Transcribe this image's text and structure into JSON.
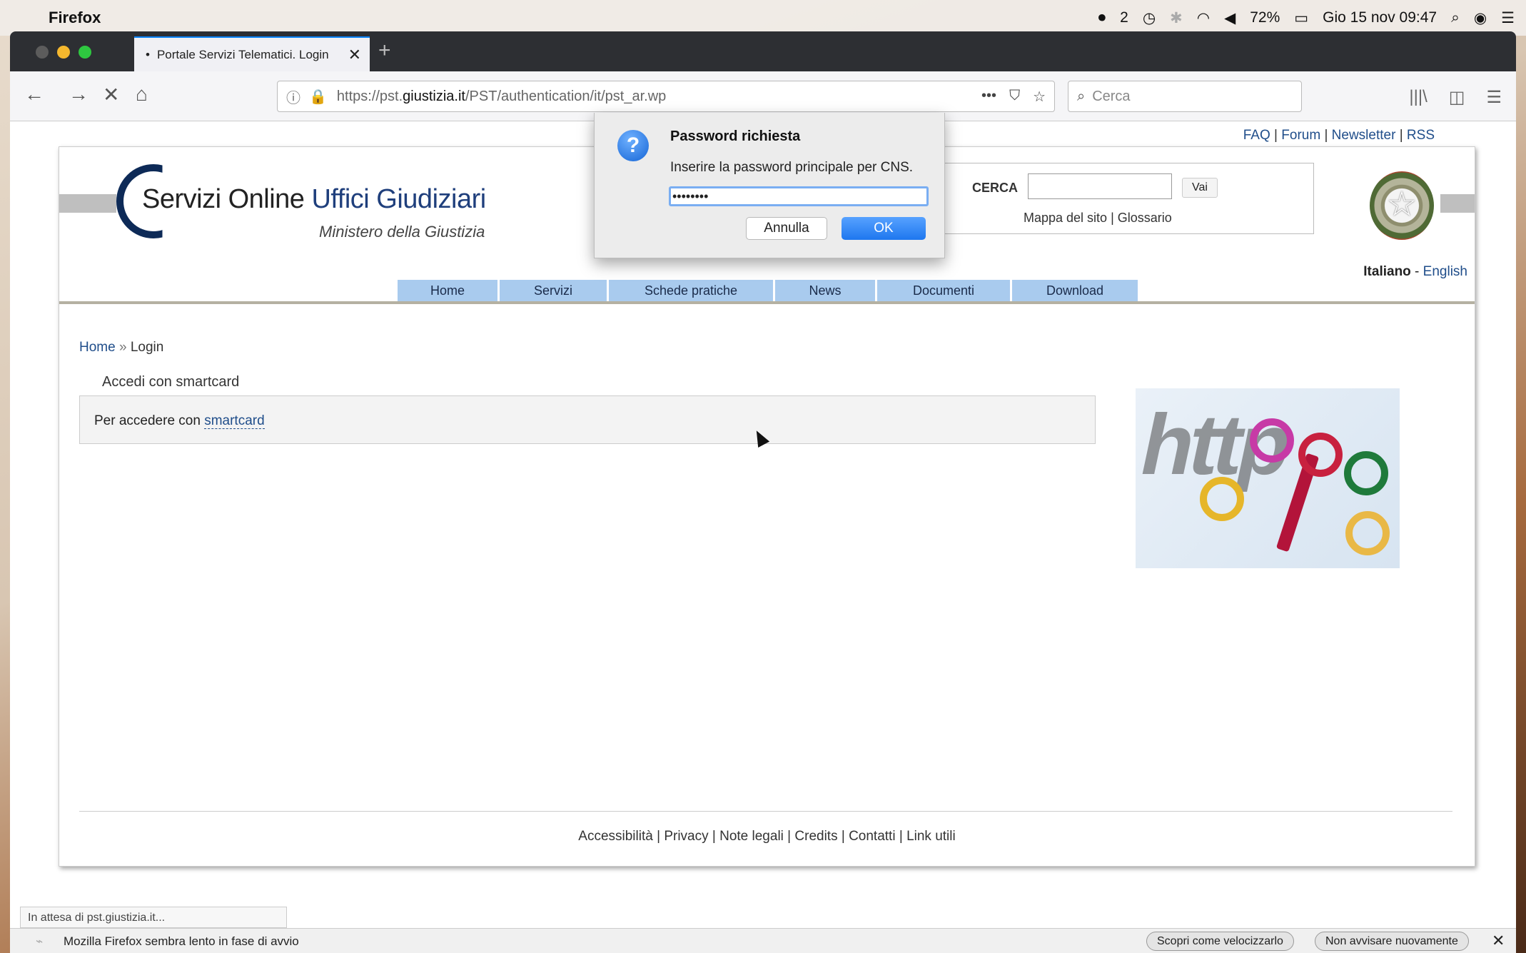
{
  "menubar": {
    "app_name": "Firefox",
    "badge_count": "2",
    "battery": "72%",
    "datetime": "Gio 15 nov  09:47"
  },
  "browser": {
    "tab_title": "Portale Servizi Telematici. Login",
    "url_prefix": "https://pst.",
    "url_domain": "giustizia.it",
    "url_path": "/PST/authentication/it/pst_ar.wp",
    "search_placeholder": "Cerca"
  },
  "site": {
    "top_links": [
      "FAQ",
      "Forum",
      "Newsletter",
      "RSS"
    ],
    "logo_main": "Servizi Online",
    "logo_blue": "Uffici Giudiziari",
    "logo_sub": "Ministero della Giustizia",
    "search_label": "CERCA",
    "search_button": "Vai",
    "sitemap_link": "Mappa del sito",
    "glossary_link": "Glossario",
    "lang_current": "Italiano",
    "lang_other": "English",
    "nav": [
      "Home",
      "Servizi",
      "Schede pratiche",
      "News",
      "Documenti",
      "Download"
    ],
    "breadcrumb_home": "Home",
    "breadcrumb_sep": " » ",
    "breadcrumb_current": "Login",
    "content_title": "Accedi con smartcard",
    "content_text": "Per accedere con ",
    "content_link": "smartcard",
    "footer_links": [
      "Accessibilità",
      "Privacy",
      "Note legali",
      "Credits",
      "Contatti",
      "Link utili"
    ]
  },
  "dialog": {
    "title": "Password richiesta",
    "message": "Inserire la password principale per CNS.",
    "password_value": "••••••••",
    "cancel_label": "Annulla",
    "ok_label": "OK"
  },
  "status_text": "In attesa di pst.giustizia.it...",
  "notification": {
    "message": "Mozilla Firefox sembra lento in fase di avvio",
    "button1": "Scopri come velocizzarlo",
    "button2": "Non avvisare nuovamente"
  }
}
